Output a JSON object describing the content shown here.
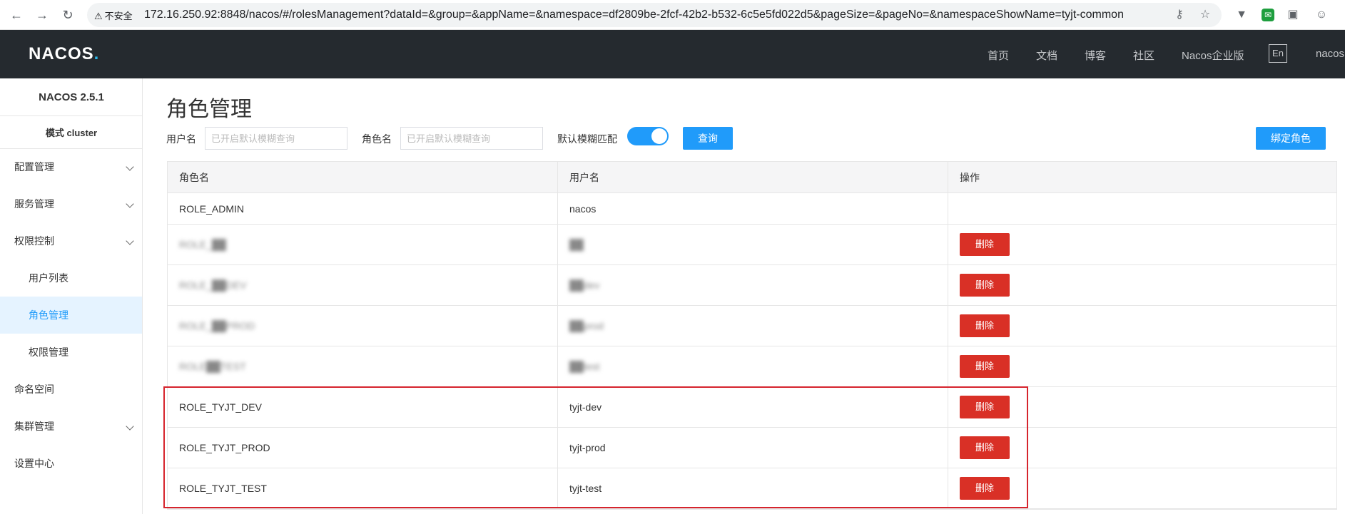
{
  "browser": {
    "security_label": "不安全",
    "url": "172.16.250.92:8848/nacos/#/rolesManagement?dataId=&group=&appName=&namespace=df2809be-2fcf-42b2-b532-6c5e5fd022d5&pageSize=&pageNo=&namespaceShowName=tyjt-common"
  },
  "header": {
    "logo_text": "NACOS",
    "logo_dot": ".",
    "nav": [
      "首页",
      "文档",
      "博客",
      "社区",
      "Nacos企业版"
    ],
    "lang": "En",
    "user": "nacos"
  },
  "sidebar": {
    "version": "NACOS 2.5.1",
    "mode": "模式 cluster",
    "items": [
      {
        "label": "配置管理",
        "chevron": true
      },
      {
        "label": "服务管理",
        "chevron": true
      },
      {
        "label": "权限控制",
        "chevron": true
      },
      {
        "label": "用户列表",
        "sub": true
      },
      {
        "label": "角色管理",
        "sub": true,
        "active": true
      },
      {
        "label": "权限管理",
        "sub": true
      },
      {
        "label": "命名空间"
      },
      {
        "label": "集群管理",
        "chevron": true
      },
      {
        "label": "设置中心"
      }
    ]
  },
  "main": {
    "title": "角色管理",
    "filters": {
      "username_label": "用户名",
      "username_placeholder": "已开启默认模糊查询",
      "rolename_label": "角色名",
      "rolename_placeholder": "已开启默认模糊查询",
      "fuzzy_label": "默认模糊匹配",
      "search_button": "查询",
      "bind_button": "绑定角色"
    },
    "table": {
      "headers": [
        "角色名",
        "用户名",
        "操作"
      ],
      "rows": [
        {
          "role": "ROLE_ADMIN",
          "user": "nacos",
          "action": ""
        },
        {
          "role": "ROLE_██",
          "user": "██",
          "action": "删除",
          "redacted": true
        },
        {
          "role": "ROLE_██DEV",
          "user": "██dev",
          "action": "删除",
          "redacted": true
        },
        {
          "role": "ROLE_██PROD",
          "user": "██prod",
          "action": "删除",
          "redacted": true
        },
        {
          "role": "ROLE██TEST",
          "user": "██test",
          "action": "删除",
          "redacted": true
        },
        {
          "role": "ROLE_TYJT_DEV",
          "user": "tyjt-dev",
          "action": "删除"
        },
        {
          "role": "ROLE_TYJT_PROD",
          "user": "tyjt-prod",
          "action": "删除"
        },
        {
          "role": "ROLE_TYJT_TEST",
          "user": "tyjt-test",
          "action": "删除"
        }
      ]
    }
  },
  "colors": {
    "header_bg": "#252a2f",
    "primary": "#209bfa",
    "danger": "#d93026",
    "highlight": "#d6242d"
  }
}
